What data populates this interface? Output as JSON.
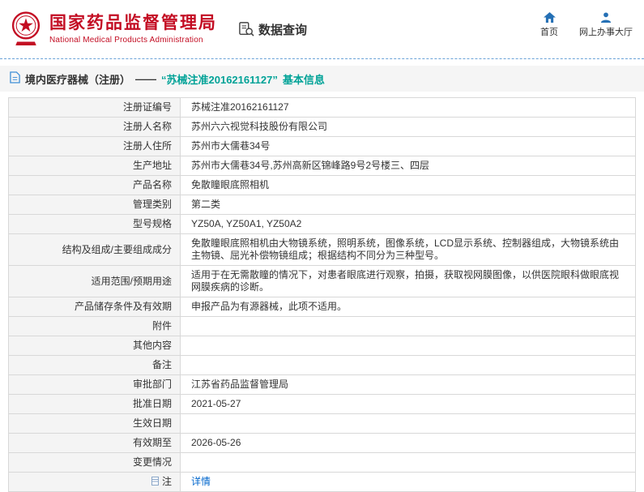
{
  "header": {
    "agency_cn": "国家药品监督管理局",
    "agency_en": "National Medical Products Administration",
    "section_title": "数据查询",
    "nav": [
      {
        "label": "首页",
        "icon": "home-icon"
      },
      {
        "label": "网上办事大厅",
        "icon": "person-icon"
      }
    ]
  },
  "page_title": {
    "prefix": "境内医疗器械（注册）",
    "dash": " —— ",
    "highlight": "“苏械注准20162161127”",
    "suffix": " 基本信息"
  },
  "table": {
    "rows": [
      {
        "label": "注册证编号",
        "value": "苏械注准20162161127"
      },
      {
        "label": "注册人名称",
        "value": "苏州六六视觉科技股份有限公司"
      },
      {
        "label": "注册人住所",
        "value": "苏州市大儒巷34号"
      },
      {
        "label": "生产地址",
        "value": "苏州市大儒巷34号,苏州高新区锦峰路9号2号楼三、四层"
      },
      {
        "label": "产品名称",
        "value": "免散瞳眼底照相机"
      },
      {
        "label": "管理类别",
        "value": "第二类"
      },
      {
        "label": "型号规格",
        "value": "YZ50A, YZ50A1, YZ50A2"
      },
      {
        "label": "结构及组成/主要组成成分",
        "value": "免散瞳眼底照相机由大物镜系统，照明系统，图像系统，LCD显示系统、控制器组成，大物镜系统由主物镜、屈光补偿物镜组成；根据结构不同分为三种型号。"
      },
      {
        "label": "适用范围/预期用途",
        "value": "适用于在无需散瞳的情况下，对患者眼底进行观察，拍摄，获取视网膜图像，以供医院眼科做眼底视网膜疾病的诊断。"
      },
      {
        "label": "产品储存条件及有效期",
        "value": "申报产品为有源器械，此项不适用。"
      },
      {
        "label": "附件",
        "value": ""
      },
      {
        "label": "其他内容",
        "value": ""
      },
      {
        "label": "备注",
        "value": ""
      },
      {
        "label": "审批部门",
        "value": "江苏省药品监督管理局"
      },
      {
        "label": "批准日期",
        "value": "2021-05-27"
      },
      {
        "label": "生效日期",
        "value": ""
      },
      {
        "label": "有效期至",
        "value": "2026-05-26"
      },
      {
        "label": "变更情况",
        "value": ""
      },
      {
        "label": "注",
        "value": "详情",
        "link": true,
        "label_icon": "note-icon"
      }
    ]
  },
  "colors": {
    "brand_red": "#c30d23",
    "highlight_teal": "#00a297",
    "link_blue": "#0066cc",
    "icon_blue": "#2570b5",
    "label_bg": "#f4f4f4",
    "border_gray": "#d8d8d8"
  }
}
